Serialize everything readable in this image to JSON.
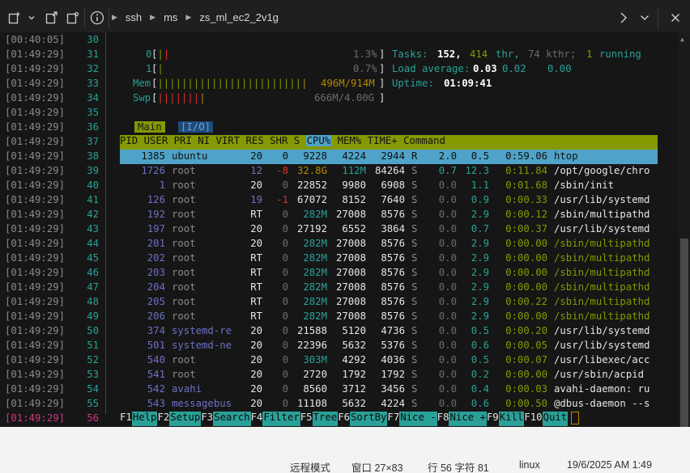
{
  "toolbar": {
    "breadcrumbs": [
      "ssh",
      "ms",
      "zs_ml_ec2_2v1g"
    ]
  },
  "meters": {
    "cpu0": {
      "label": "0",
      "value": "1.3%"
    },
    "cpu1": {
      "label": "1",
      "value": "0.7%"
    },
    "mem": {
      "label": "Mem",
      "value": "496M/914M"
    },
    "swp": {
      "label": "Swp",
      "value": "666M/4.00G"
    },
    "tasks_label": "Tasks:",
    "tasks": "152,",
    "thr": "414",
    "thr_label": "thr,",
    "kthr": "74 kthr;",
    "running": "1",
    "running_label": "running",
    "load_label": "Load average:",
    "load1": "0.03",
    "load5": "0.02",
    "load15": "0.00",
    "uptime_label": "Uptime:",
    "uptime": "01:09:41"
  },
  "tabs": {
    "main": "Main",
    "io": "[I/O]"
  },
  "header": {
    "pid": "PID",
    "user": "USER",
    "pri": "PRI",
    "ni": "NI",
    "virt": "VIRT",
    "res": "RES",
    "shr": "SHR",
    "s": "S",
    "cpu": "CPU%",
    "mem": "MEM%",
    "time": "TIME+",
    "command": "Command"
  },
  "timestamps": [
    "[00:40:05]",
    "[01:49:29]",
    "[01:49:29]",
    "[01:49:29]",
    "[01:49:29]",
    "[01:49:29]",
    "[01:49:29]",
    "[01:49:29]",
    "[01:49:29]",
    "[01:49:29]",
    "[01:49:29]",
    "[01:49:29]",
    "[01:49:29]",
    "[01:49:29]",
    "[01:49:29]",
    "[01:49:29]",
    "[01:49:29]",
    "[01:49:29]",
    "[01:49:29]",
    "[01:49:29]",
    "[01:49:29]",
    "[01:49:29]",
    "[01:49:29]",
    "[01:49:29]",
    "[01:49:29]",
    "[01:49:29]",
    "[01:49:29]"
  ],
  "line_numbers": [
    "30",
    "31",
    "32",
    "33",
    "34",
    "35",
    "36",
    "37",
    "38",
    "39",
    "40",
    "41",
    "42",
    "43",
    "44",
    "45",
    "46",
    "47",
    "48",
    "49",
    "50",
    "51",
    "52",
    "53",
    "54",
    "55",
    "56"
  ],
  "processes": [
    {
      "pid": "1385",
      "user": "ubuntu",
      "pri": "20",
      "ni": "0",
      "virt": "9228",
      "res": "4224",
      "shr": "2944",
      "s": "R",
      "cpu": "2.0",
      "mem": "0.5",
      "time": "0:59.06",
      "cmd": "htop"
    },
    {
      "pid": "1726",
      "user": "root",
      "pri": "12",
      "ni": "-8",
      "virt": "32.8G",
      "res": "112M",
      "shr": "84264",
      "s": "S",
      "cpu": "0.7",
      "mem": "12.3",
      "time": "0:11.84",
      "cmd": "/opt/google/chro"
    },
    {
      "pid": "1",
      "user": "root",
      "pri": "20",
      "ni": "0",
      "virt": "22852",
      "res": "9980",
      "shr": "6908",
      "s": "S",
      "cpu": "0.0",
      "mem": "1.1",
      "time": "0:01.68",
      "cmd": "/sbin/init"
    },
    {
      "pid": "126",
      "user": "root",
      "pri": "19",
      "ni": "-1",
      "virt": "67072",
      "res": "8152",
      "shr": "7640",
      "s": "S",
      "cpu": "0.0",
      "mem": "0.9",
      "time": "0:00.33",
      "cmd": "/usr/lib/systemd"
    },
    {
      "pid": "192",
      "user": "root",
      "pri": "RT",
      "ni": "0",
      "virt": "282M",
      "res": "27008",
      "shr": "8576",
      "s": "S",
      "cpu": "0.0",
      "mem": "2.9",
      "time": "0:00.12",
      "cmd": "/sbin/multipathd"
    },
    {
      "pid": "197",
      "user": "root",
      "pri": "20",
      "ni": "0",
      "virt": "27192",
      "res": "6552",
      "shr": "3864",
      "s": "S",
      "cpu": "0.0",
      "mem": "0.7",
      "time": "0:00.37",
      "cmd": "/usr/lib/systemd"
    },
    {
      "pid": "201",
      "user": "root",
      "pri": "20",
      "ni": "0",
      "virt": "282M",
      "res": "27008",
      "shr": "8576",
      "s": "S",
      "cpu": "0.0",
      "mem": "2.9",
      "time": "0:00.00",
      "cmd": "/sbin/multipathd"
    },
    {
      "pid": "202",
      "user": "root",
      "pri": "RT",
      "ni": "0",
      "virt": "282M",
      "res": "27008",
      "shr": "8576",
      "s": "S",
      "cpu": "0.0",
      "mem": "2.9",
      "time": "0:00.00",
      "cmd": "/sbin/multipathd"
    },
    {
      "pid": "203",
      "user": "root",
      "pri": "RT",
      "ni": "0",
      "virt": "282M",
      "res": "27008",
      "shr": "8576",
      "s": "S",
      "cpu": "0.0",
      "mem": "2.9",
      "time": "0:00.00",
      "cmd": "/sbin/multipathd"
    },
    {
      "pid": "204",
      "user": "root",
      "pri": "RT",
      "ni": "0",
      "virt": "282M",
      "res": "27008",
      "shr": "8576",
      "s": "S",
      "cpu": "0.0",
      "mem": "2.9",
      "time": "0:00.00",
      "cmd": "/sbin/multipathd"
    },
    {
      "pid": "205",
      "user": "root",
      "pri": "RT",
      "ni": "0",
      "virt": "282M",
      "res": "27008",
      "shr": "8576",
      "s": "S",
      "cpu": "0.0",
      "mem": "2.9",
      "time": "0:00.22",
      "cmd": "/sbin/multipathd"
    },
    {
      "pid": "206",
      "user": "root",
      "pri": "RT",
      "ni": "0",
      "virt": "282M",
      "res": "27008",
      "shr": "8576",
      "s": "S",
      "cpu": "0.0",
      "mem": "2.9",
      "time": "0:00.00",
      "cmd": "/sbin/multipathd"
    },
    {
      "pid": "374",
      "user": "systemd-re",
      "pri": "20",
      "ni": "0",
      "virt": "21588",
      "res": "5120",
      "shr": "4736",
      "s": "S",
      "cpu": "0.0",
      "mem": "0.5",
      "time": "0:00.20",
      "cmd": "/usr/lib/systemd"
    },
    {
      "pid": "501",
      "user": "systemd-ne",
      "pri": "20",
      "ni": "0",
      "virt": "22396",
      "res": "5632",
      "shr": "5376",
      "s": "S",
      "cpu": "0.0",
      "mem": "0.6",
      "time": "0:00.05",
      "cmd": "/usr/lib/systemd"
    },
    {
      "pid": "540",
      "user": "root",
      "pri": "20",
      "ni": "0",
      "virt": "303M",
      "res": "4292",
      "shr": "4036",
      "s": "S",
      "cpu": "0.0",
      "mem": "0.5",
      "time": "0:00.07",
      "cmd": "/usr/libexec/acc"
    },
    {
      "pid": "541",
      "user": "root",
      "pri": "20",
      "ni": "0",
      "virt": "2720",
      "res": "1792",
      "shr": "1792",
      "s": "S",
      "cpu": "0.0",
      "mem": "0.2",
      "time": "0:00.00",
      "cmd": "/usr/sbin/acpid"
    },
    {
      "pid": "542",
      "user": "avahi",
      "pri": "20",
      "ni": "0",
      "virt": "8560",
      "res": "3712",
      "shr": "3456",
      "s": "S",
      "cpu": "0.0",
      "mem": "0.4",
      "time": "0:00.03",
      "cmd": "avahi-daemon: ru"
    },
    {
      "pid": "543",
      "user": "messagebus",
      "pri": "20",
      "ni": "0",
      "virt": "11108",
      "res": "5632",
      "shr": "4224",
      "s": "S",
      "cpu": "0.0",
      "mem": "0.6",
      "time": "0:00.50",
      "cmd": "@dbus-daemon --s"
    }
  ],
  "fkeys": [
    {
      "key": "F1",
      "label": "Help  "
    },
    {
      "key": "F2",
      "label": "Setup "
    },
    {
      "key": "F3",
      "label": "Search"
    },
    {
      "key": "F4",
      "label": "Filter"
    },
    {
      "key": "F5",
      "label": "Tree  "
    },
    {
      "key": "F6",
      "label": "SortBy"
    },
    {
      "key": "F7",
      "label": "Nice -"
    },
    {
      "key": "F8",
      "label": "Nice +"
    },
    {
      "key": "F9",
      "label": "Kill  "
    },
    {
      "key": "F10",
      "label": "Quit  "
    }
  ],
  "statusbar": {
    "mode": "远程模式",
    "window": "窗口 27×83",
    "position": "行 56 字符 81",
    "os": "linux",
    "datetime": "19/6/2025 AM 1:49"
  }
}
